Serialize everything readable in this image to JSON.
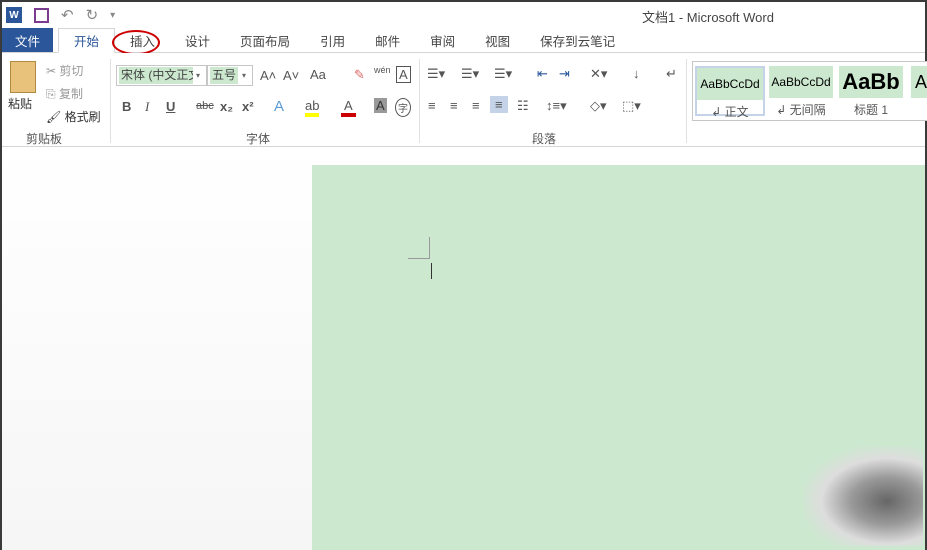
{
  "window": {
    "title": "文档1 - Microsoft Word"
  },
  "qat": {
    "word_icon": "W",
    "undo": "↶",
    "redo": "↻",
    "customize": "▾"
  },
  "tabs": [
    "文件",
    "开始",
    "插入",
    "设计",
    "页面布局",
    "引用",
    "邮件",
    "审阅",
    "视图",
    "保存到云笔记"
  ],
  "clipboard": {
    "paste": "粘贴",
    "cut": "剪切",
    "copy": "复制",
    "format_painter": "格式刷",
    "label": "剪贴板"
  },
  "font": {
    "name": "宋体 (中文正文)",
    "size": "五号",
    "label": "字体",
    "grow": "A˄",
    "shrink": "A˅",
    "case": "Aa",
    "clear": "✎",
    "phonetic": "wén",
    "border_char": "A",
    "bold": "B",
    "italic": "I",
    "underline": "U",
    "strike": "abc",
    "sub": "x₂",
    "sup": "x²",
    "effects": "A",
    "highlight": "ab",
    "color": "A",
    "shading": "A",
    "enclose": "字"
  },
  "paragraph": {
    "label": "段落"
  },
  "styles": [
    {
      "sample": "AaBbCcDd",
      "name": "↲ 正文"
    },
    {
      "sample": "AaBbCcDd",
      "name": "↲ 无间隔"
    },
    {
      "sample": "AaBb",
      "name": "标题 1"
    },
    {
      "sample": "A",
      "name": ""
    }
  ]
}
